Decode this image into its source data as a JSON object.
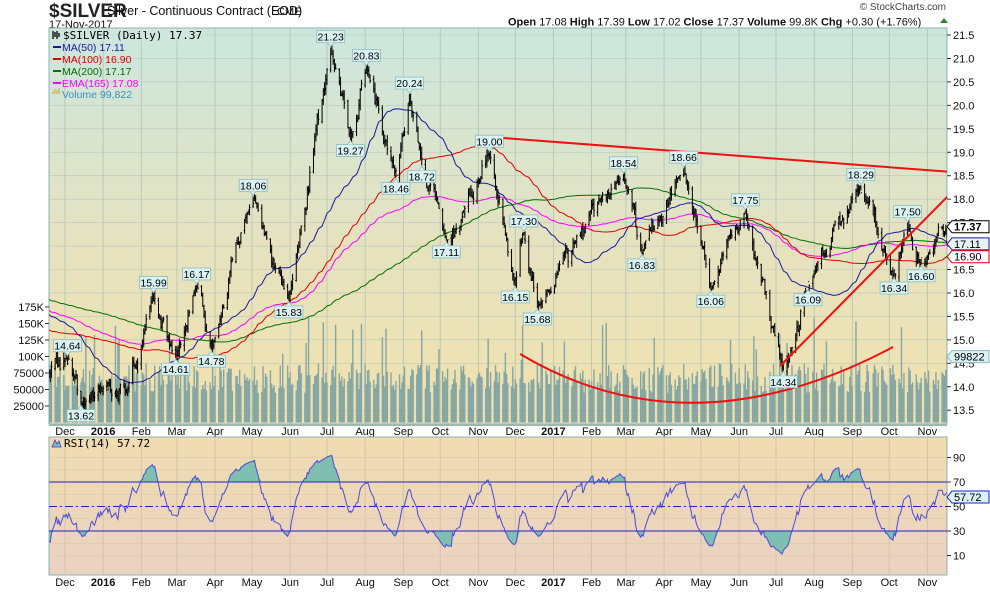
{
  "header": {
    "symbol": "$SILVER",
    "name": "Silver - Continuous Contract (EOD)",
    "exchange": "CME",
    "date": "17-Nov-2017",
    "watermark": "© StockCharts.com",
    "ohlc": {
      "open_label": "Open",
      "open": "17.08",
      "high_label": "High",
      "high": "17.39",
      "low_label": "Low",
      "low": "17.02",
      "close_label": "Close",
      "close": "17.37",
      "volume_label": "Volume",
      "volume": "99.8K",
      "chg_label": "Chg",
      "chg": "+0.30 (+1.76%)"
    }
  },
  "legend": {
    "price": "$SILVER (Daily) 17.37",
    "ma50": "MA(50) 17.11",
    "ma100": "MA(100) 16.90",
    "ma200": "MA(200) 17.17",
    "ema165": "EMA(165) 17.08",
    "volume": "Volume 99,822",
    "rsi": "RSI(14) 57.72"
  },
  "colors": {
    "price": "#000000",
    "ma50": "#1a1a9c",
    "ma100": "#e00000",
    "ma200": "#007000",
    "ema165": "#ff00ff",
    "volume": "#86a6a3",
    "rsi": "#4a4ad8",
    "trendline": "#ee1111"
  },
  "chart_data": [
    {
      "type": "ohlc",
      "title": "$SILVER (Daily)",
      "x_range": [
        "2015-11-18",
        "2017-11-17"
      ],
      "ylim": [
        13.5,
        21.5
      ],
      "y_ticks": [
        "13.5",
        "14.0",
        "14.5",
        "15.0",
        "15.5",
        "16.0",
        "16.5",
        "17.0",
        "17.5",
        "18.0",
        "18.5",
        "19.0",
        "19.5",
        "20.0",
        "20.5",
        "21.0",
        "21.5"
      ],
      "x_ticks": [
        {
          "label": "Dec",
          "date": "2015-12-01"
        },
        {
          "label": "2016",
          "date": "2016-01-01",
          "bold": true
        },
        {
          "label": "Feb",
          "date": "2016-02-01"
        },
        {
          "label": "Mar",
          "date": "2016-03-01"
        },
        {
          "label": "Apr",
          "date": "2016-04-01"
        },
        {
          "label": "May",
          "date": "2016-05-01"
        },
        {
          "label": "Jun",
          "date": "2016-06-01"
        },
        {
          "label": "Jul",
          "date": "2016-07-01"
        },
        {
          "label": "Aug",
          "date": "2016-08-01"
        },
        {
          "label": "Sep",
          "date": "2016-09-01"
        },
        {
          "label": "Oct",
          "date": "2016-10-01"
        },
        {
          "label": "Nov",
          "date": "2016-11-01"
        },
        {
          "label": "Dec",
          "date": "2016-12-01"
        },
        {
          "label": "2017",
          "date": "2017-01-01",
          "bold": true
        },
        {
          "label": "Feb",
          "date": "2017-02-01"
        },
        {
          "label": "Mar",
          "date": "2017-03-01"
        },
        {
          "label": "Apr",
          "date": "2017-04-01"
        },
        {
          "label": "May",
          "date": "2017-05-01"
        },
        {
          "label": "Jun",
          "date": "2017-06-01"
        },
        {
          "label": "Jul",
          "date": "2017-07-01"
        },
        {
          "label": "Aug",
          "date": "2017-08-01"
        },
        {
          "label": "Sep",
          "date": "2017-09-01"
        },
        {
          "label": "Oct",
          "date": "2017-10-01"
        },
        {
          "label": "Nov",
          "date": "2017-11-01"
        }
      ],
      "pivots": [
        {
          "date": "2015-11-18",
          "value": 14.2
        },
        {
          "date": "2015-12-03",
          "value": 14.64,
          "label": "14.64"
        },
        {
          "date": "2015-12-14",
          "value": 13.62,
          "label": "13.62"
        },
        {
          "date": "2016-01-05",
          "value": 14.1
        },
        {
          "date": "2016-01-20",
          "value": 13.85
        },
        {
          "date": "2016-02-11",
          "value": 15.99,
          "label": "15.99"
        },
        {
          "date": "2016-02-29",
          "value": 14.61,
          "label": "14.61"
        },
        {
          "date": "2016-03-17",
          "value": 16.17,
          "label": "16.17"
        },
        {
          "date": "2016-03-29",
          "value": 14.78,
          "label": "14.78"
        },
        {
          "date": "2016-05-02",
          "value": 18.06,
          "label": "18.06"
        },
        {
          "date": "2016-05-31",
          "value": 15.83,
          "label": "15.83"
        },
        {
          "date": "2016-07-04",
          "value": 21.23,
          "label": "21.23"
        },
        {
          "date": "2016-07-20",
          "value": 19.27,
          "label": "19.27"
        },
        {
          "date": "2016-08-02",
          "value": 20.83,
          "label": "20.83"
        },
        {
          "date": "2016-08-26",
          "value": 18.46,
          "label": "18.46"
        },
        {
          "date": "2016-09-06",
          "value": 20.24,
          "label": "20.24"
        },
        {
          "date": "2016-09-16",
          "value": 18.72,
          "label": "18.72"
        },
        {
          "date": "2016-10-06",
          "value": 17.11,
          "label": "17.11"
        },
        {
          "date": "2016-10-20",
          "value": 17.7
        },
        {
          "date": "2016-11-10",
          "value": 19.0,
          "label": "19.00"
        },
        {
          "date": "2016-12-01",
          "value": 16.15,
          "label": "16.15"
        },
        {
          "date": "2016-12-08",
          "value": 17.3,
          "label": "17.30"
        },
        {
          "date": "2016-12-19",
          "value": 15.68,
          "label": "15.68"
        },
        {
          "date": "2017-02-27",
          "value": 18.54,
          "label": "18.54"
        },
        {
          "date": "2017-03-14",
          "value": 16.83,
          "label": "16.83"
        },
        {
          "date": "2017-04-17",
          "value": 18.66,
          "label": "18.66"
        },
        {
          "date": "2017-05-09",
          "value": 16.06,
          "label": "16.06"
        },
        {
          "date": "2017-06-06",
          "value": 17.75,
          "label": "17.75"
        },
        {
          "date": "2017-07-07",
          "value": 14.34,
          "label": "14.34"
        },
        {
          "date": "2017-07-27",
          "value": 16.09,
          "label": "16.09"
        },
        {
          "date": "2017-09-08",
          "value": 18.29,
          "label": "18.29"
        },
        {
          "date": "2017-10-05",
          "value": 16.34,
          "label": "16.34"
        },
        {
          "date": "2017-10-16",
          "value": 17.5,
          "label": "17.50"
        },
        {
          "date": "2017-10-27",
          "value": 16.6,
          "label": "16.60"
        },
        {
          "date": "2017-11-17",
          "value": 17.37
        }
      ],
      "last_values": {
        "close": "17.37",
        "ma50": "17.11",
        "ma100": "16.90",
        "volume": "99822"
      },
      "series": [
        {
          "name": "MA(50)",
          "value": 17.11
        },
        {
          "name": "MA(100)",
          "value": 16.9
        },
        {
          "name": "MA(200)",
          "value": 17.17
        },
        {
          "name": "EMA(165)",
          "value": 17.08
        },
        {
          "name": "Volume",
          "value": 99822
        }
      ],
      "volume_axis": {
        "ticks": [
          "25000",
          "50000",
          "75000",
          "100K",
          "125K",
          "150K",
          "175K"
        ],
        "values": [
          25000,
          50000,
          75000,
          100000,
          125000,
          150000,
          175000
        ]
      },
      "grid": true
    },
    {
      "type": "line",
      "title": "RSI(14) 57.72",
      "ylim": [
        0,
        100
      ],
      "y_ticks": [
        "10",
        "30",
        "50",
        "70",
        "90"
      ],
      "levels": [
        30,
        50,
        70
      ],
      "last_value": "57.72",
      "grid": true
    }
  ]
}
